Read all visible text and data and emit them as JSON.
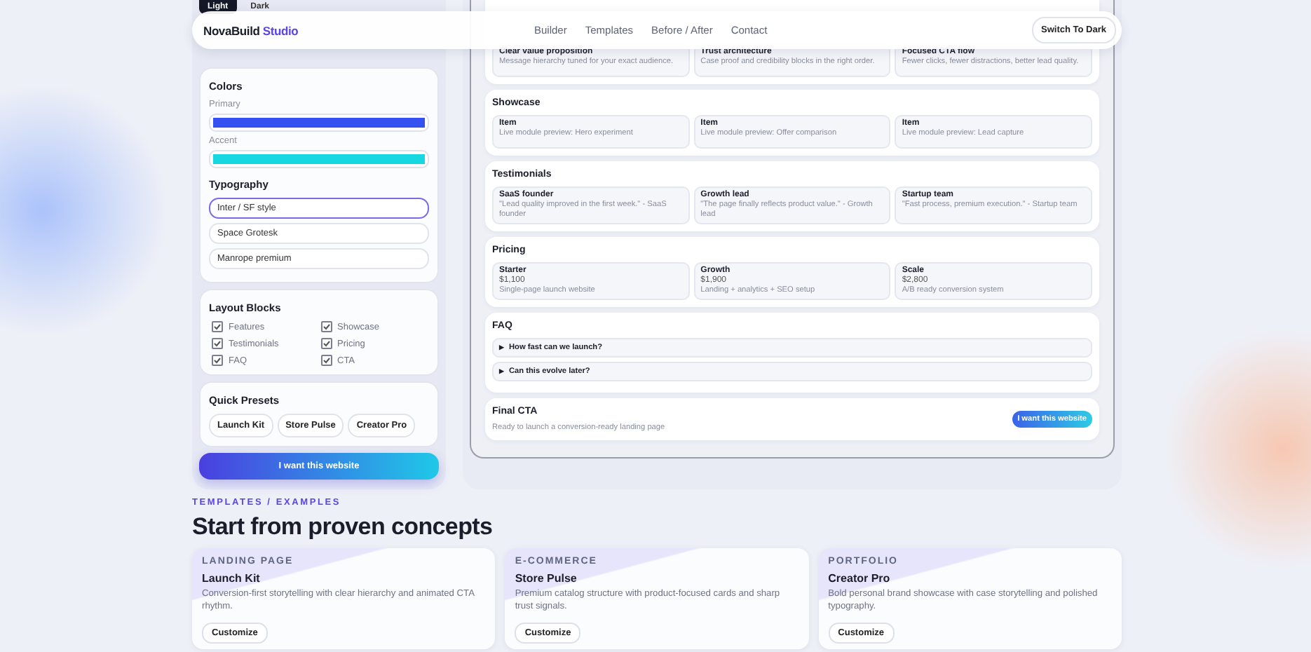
{
  "theme_toggle": [
    {
      "label": "Light",
      "selected": true
    },
    {
      "label": "Dark",
      "selected": false
    }
  ],
  "nav": {
    "brand": "NovaBuild",
    "brand_accent": "Studio",
    "links": [
      "Builder",
      "Templates",
      "Before / After",
      "Contact"
    ],
    "action": "Switch To Dark"
  },
  "sidebar": {
    "colors": {
      "title": "Colors",
      "fields": [
        {
          "label": "Primary",
          "color": "#3552f0"
        },
        {
          "label": "Accent",
          "color": "#17d8e0"
        }
      ]
    },
    "typography": {
      "title": "Typography",
      "options": [
        {
          "label": "Inter / SF style",
          "selected": true
        },
        {
          "label": "Space Grotesk",
          "selected": false
        },
        {
          "label": "Manrope premium",
          "selected": false
        }
      ]
    },
    "layout_blocks": {
      "title": "Layout Blocks",
      "items": [
        {
          "label": "Features",
          "checked": true
        },
        {
          "label": "Showcase",
          "checked": true
        },
        {
          "label": "Testimonials",
          "checked": true
        },
        {
          "label": "Pricing",
          "checked": true
        },
        {
          "label": "FAQ",
          "checked": true
        },
        {
          "label": "CTA",
          "checked": true
        }
      ]
    },
    "presets": {
      "title": "Quick Presets",
      "buttons": [
        "Launch Kit",
        "Store Pulse",
        "Creator Pro"
      ]
    },
    "cta": "I want this website"
  },
  "preview": {
    "sections": [
      {
        "kind": "cards",
        "cards": [
          {
            "title": "Clear value proposition",
            "text": "Message hierarchy tuned for your exact audience."
          },
          {
            "title": "Trust architecture",
            "text": "Case proof and credibility blocks in the right order."
          },
          {
            "title": "Focused CTA flow",
            "text": "Fewer clicks, fewer distractions, better lead quality."
          }
        ]
      },
      {
        "kind": "cards",
        "title": "Showcase",
        "cards": [
          {
            "title": "Item",
            "text": "Live module preview: Hero experiment"
          },
          {
            "title": "Item",
            "text": "Live module preview: Offer comparison"
          },
          {
            "title": "Item",
            "text": "Live module preview: Lead capture"
          }
        ]
      },
      {
        "kind": "cards",
        "title": "Testimonials",
        "cards": [
          {
            "title": "SaaS founder",
            "text": "\"Lead quality improved in the first week.\" - SaaS founder"
          },
          {
            "title": "Growth lead",
            "text": "\"The page finally reflects product value.\" - Growth lead"
          },
          {
            "title": "Startup team",
            "text": "\"Fast process, premium execution.\" - Startup team"
          }
        ]
      },
      {
        "kind": "cards",
        "title": "Pricing",
        "cards": [
          {
            "title": "Starter",
            "price": "$1,100",
            "text": "Single-page launch website"
          },
          {
            "title": "Growth",
            "price": "$1,900",
            "text": "Landing + analytics + SEO setup"
          },
          {
            "title": "Scale",
            "price": "$2,800",
            "text": "A/B ready conversion system"
          }
        ]
      },
      {
        "kind": "faq",
        "title": "FAQ",
        "items": [
          {
            "marker": "▶",
            "question": "How fast can we launch?",
            "expanded": false
          },
          {
            "marker": "▶",
            "question": "Can this evolve later?",
            "expanded": false
          }
        ]
      },
      {
        "kind": "cta",
        "title": "Final CTA",
        "text": "Ready to launch a conversion-ready landing page",
        "button": "I want this website"
      }
    ]
  },
  "templates": {
    "eyebrow": "TEMPLATES / EXAMPLES",
    "heading": "Start from proven concepts",
    "cards": [
      {
        "tag": "LANDING PAGE",
        "title": "Launch Kit",
        "text": "Conversion-first storytelling with clear hierarchy and animated CTA rhythm.",
        "button": "Customize"
      },
      {
        "tag": "E-COMMERCE",
        "title": "Store Pulse",
        "text": "Premium catalog structure with product-focused cards and sharp trust signals.",
        "button": "Customize"
      },
      {
        "tag": "PORTFOLIO",
        "title": "Creator Pro",
        "text": "Bold personal brand showcase with case storytelling and polished typography.",
        "button": "Customize"
      }
    ]
  }
}
